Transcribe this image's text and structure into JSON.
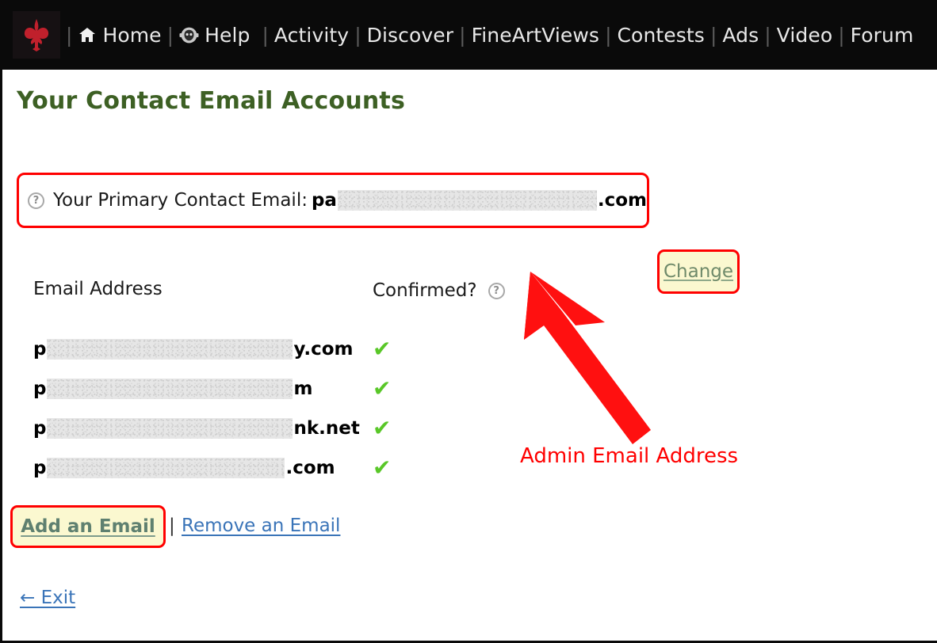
{
  "navbar": {
    "logo_alt": "site-logo",
    "items": [
      {
        "label": "Home",
        "icon": "home-icon"
      },
      {
        "label": "Help",
        "icon": "help-icon"
      },
      {
        "label": "Activity",
        "icon": null
      },
      {
        "label": "Discover",
        "icon": null
      },
      {
        "label": "FineArtViews",
        "icon": null
      },
      {
        "label": "Contests",
        "icon": null
      },
      {
        "label": "Ads",
        "icon": null
      },
      {
        "label": "Video",
        "icon": null
      },
      {
        "label": "Forum",
        "icon": null
      }
    ],
    "separator": "|",
    "background_color": "#0a0a0a",
    "text_color": "#e8e8e8"
  },
  "page": {
    "title": "Your Contact Email Accounts",
    "title_color": "#3d6024"
  },
  "primary": {
    "help_icon": "?",
    "label": "Your Primary Contact Email:",
    "value_prefix": "pa",
    "value_redacted": true,
    "value_suffix": ".com",
    "change_label": "Change",
    "highlight_color": "#ff0000",
    "button_background": "#fbf8d0"
  },
  "table": {
    "headers": [
      "Email Address",
      "Confirmed?"
    ],
    "confirmed_help_icon": "?",
    "rows": [
      {
        "prefix": "p",
        "redacted": true,
        "suffix": "y.com",
        "confirmed": true,
        "confirmed_mark": "✔",
        "redact_width": 310
      },
      {
        "prefix": "p",
        "redacted": true,
        "suffix": "m",
        "confirmed": true,
        "confirmed_mark": "✔",
        "redact_width": 310
      },
      {
        "prefix": "p",
        "redacted": true,
        "suffix": "nk.net",
        "confirmed": true,
        "confirmed_mark": "✔",
        "redact_width": 310
      },
      {
        "prefix": "p",
        "redacted": true,
        "suffix": ".com",
        "confirmed": true,
        "confirmed_mark": "✔",
        "redact_width": 300
      }
    ],
    "check_color": "#59c728"
  },
  "actions": {
    "add_label": "Add an Email",
    "separator": "|",
    "remove_label": "Remove an Email",
    "exit_label": "← Exit",
    "link_color": "#3a74b8"
  },
  "annotation": {
    "text": "Admin Email Address",
    "color": "#ff0000",
    "arrow": "red-arrow-up-left"
  }
}
